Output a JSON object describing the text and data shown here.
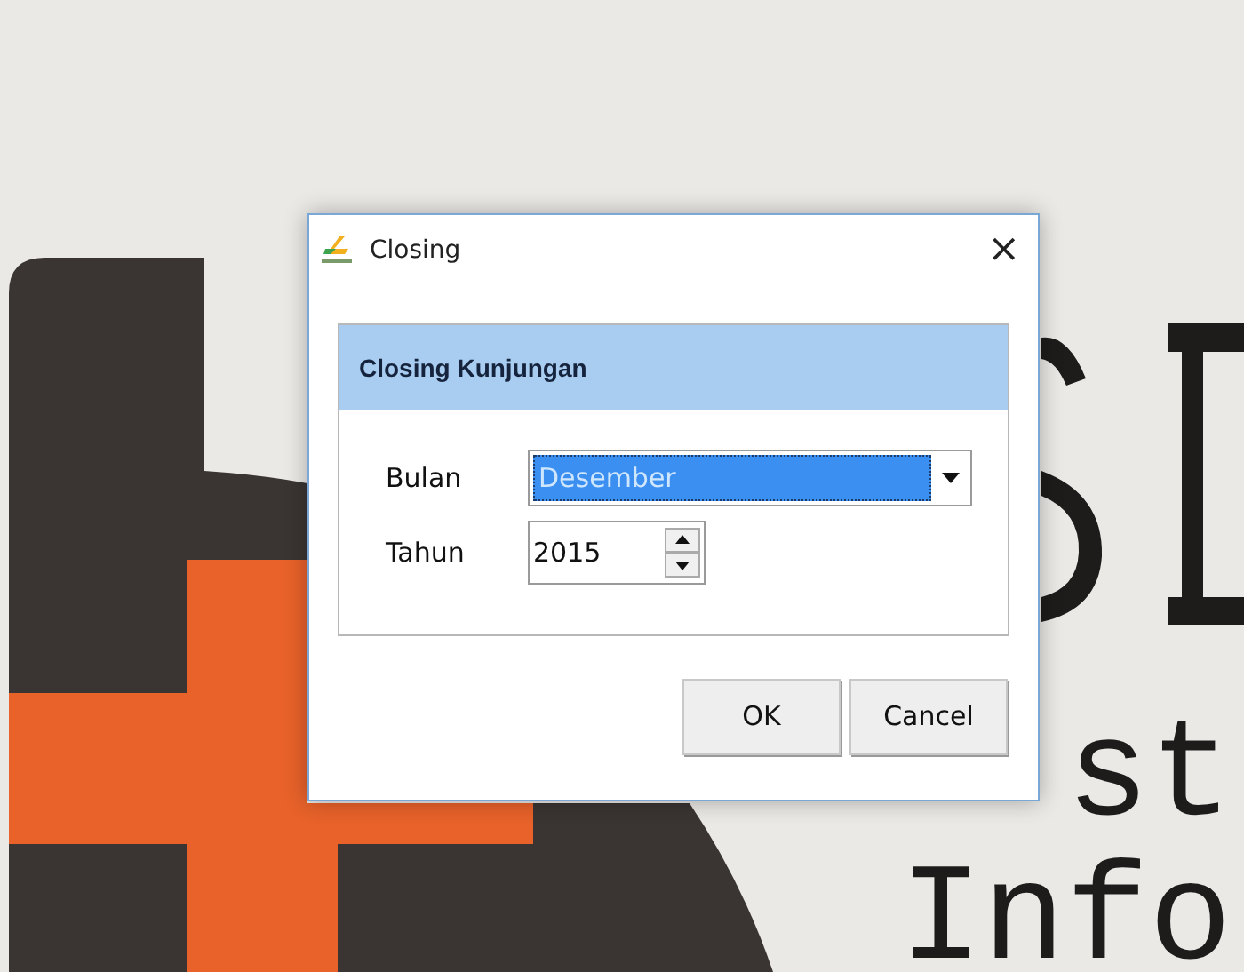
{
  "background": {
    "texts": [
      "st",
      "Info"
    ]
  },
  "window": {
    "title": "Closing",
    "close": "×"
  },
  "panel": {
    "heading": "Closing Kunjungan",
    "fields": [
      {
        "kind": "select",
        "label": "Bulan",
        "value": "Desember",
        "selected": true
      },
      {
        "kind": "spinner",
        "label": "Tahun",
        "value": "2015",
        "selected": false
      }
    ]
  },
  "buttons": [
    "OK",
    "Cancel"
  ]
}
